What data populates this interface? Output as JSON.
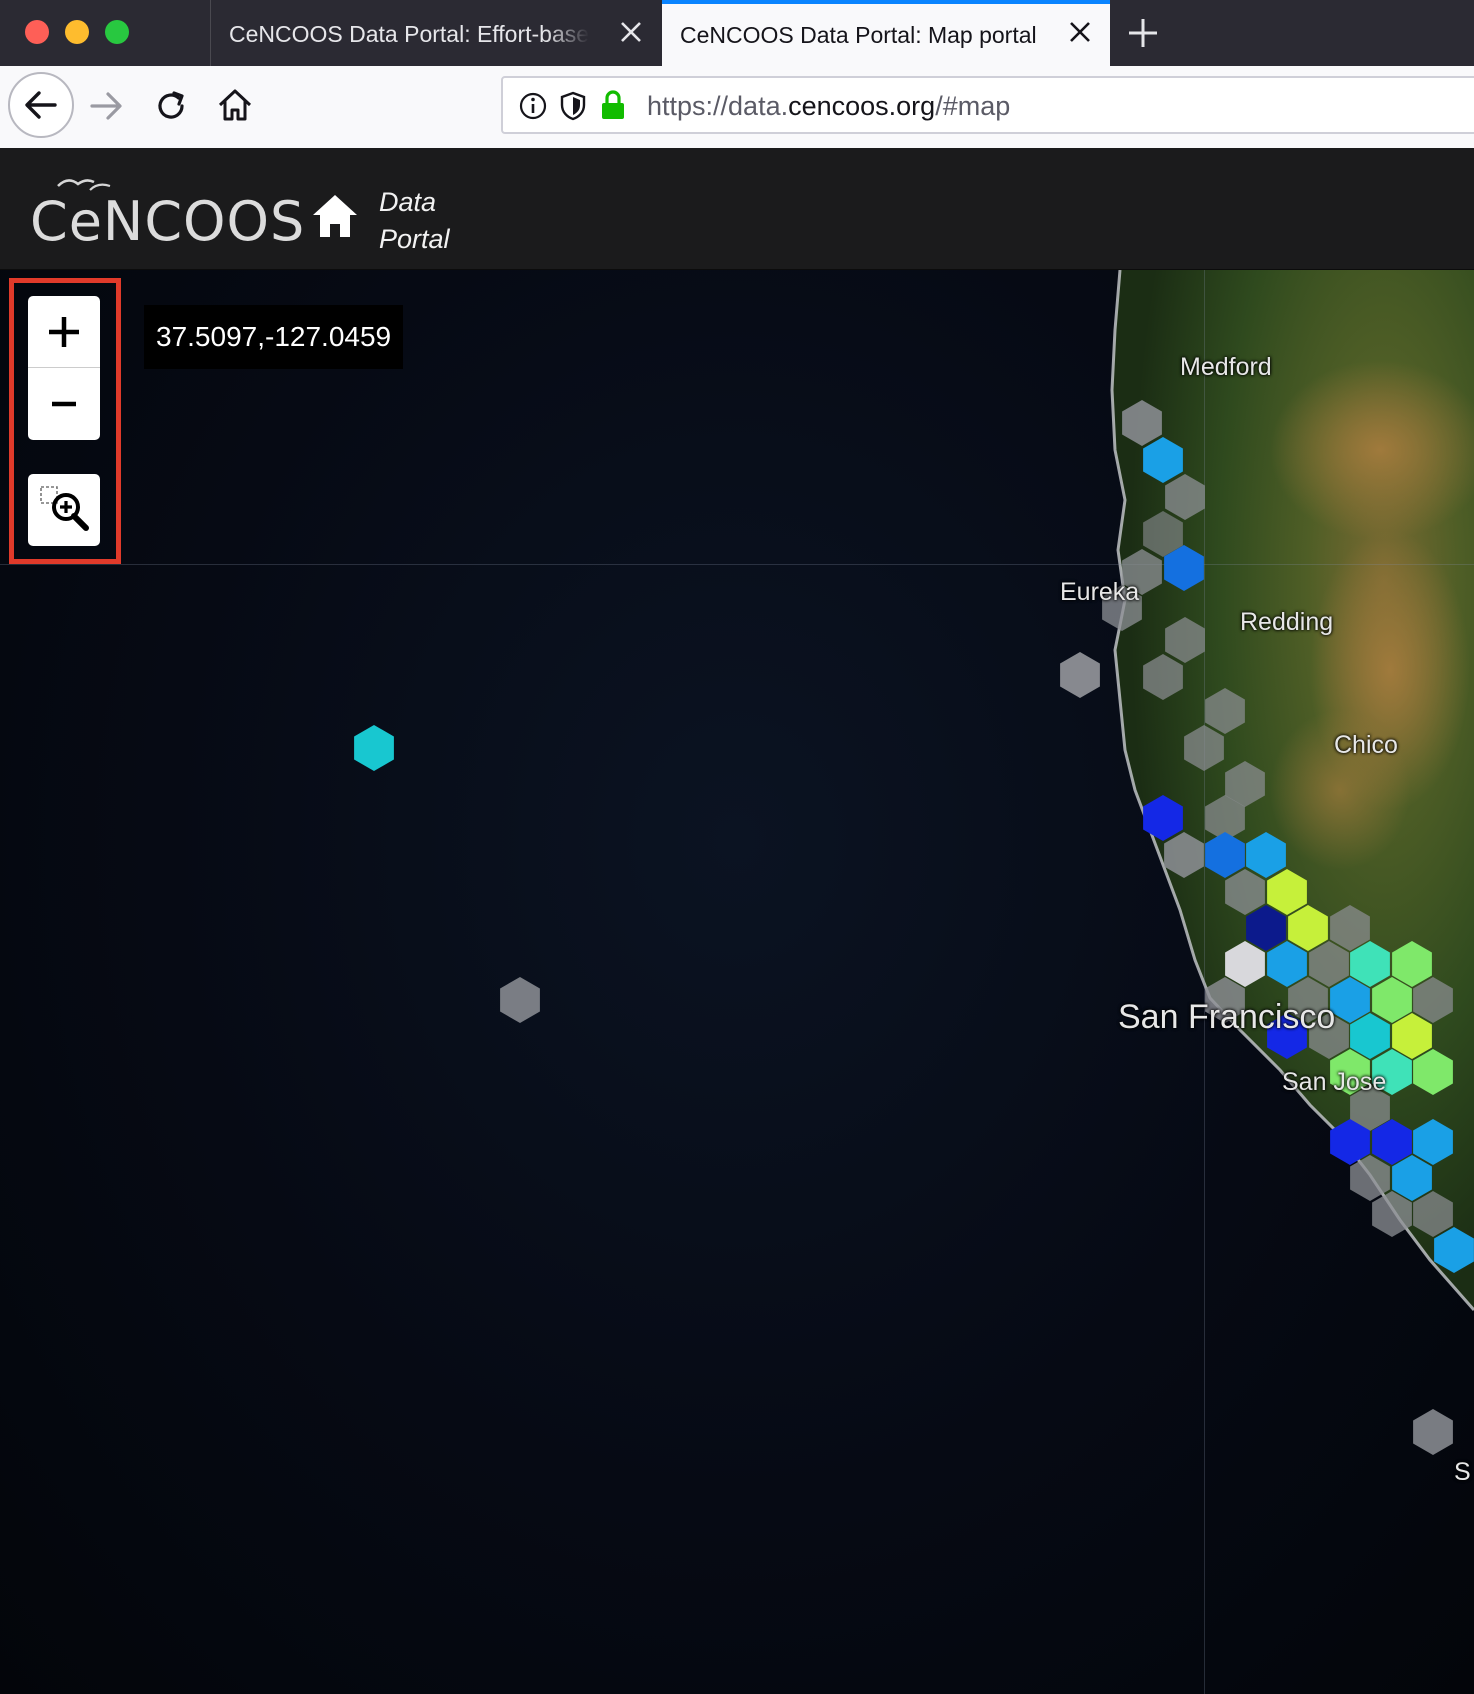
{
  "browser": {
    "tabs": [
      {
        "title": "CeNCOOS Data Portal: Effort-based",
        "active": false
      },
      {
        "title": "CeNCOOS Data Portal: Map portal",
        "active": true
      }
    ],
    "url": {
      "prefix": "https://data.",
      "domain": "cencoos.org",
      "suffix": "/#map"
    }
  },
  "site": {
    "logo": "CeNCOOS",
    "nav_label_line1": "Data",
    "nav_label_line2": "Portal"
  },
  "map": {
    "cursor_coordinates": "37.5097,-127.0459",
    "zoom_in_label": "+",
    "zoom_out_label": "−",
    "cities": {
      "medford": "Medford",
      "eureka": "Eureka",
      "redding": "Redding",
      "chico": "Chico",
      "san_francisco": "San Francisco",
      "san_jose": "San Jose",
      "partial": "S"
    },
    "highlight_color": "#e03a2a",
    "hex_colors": {
      "gray": "#8e9096",
      "light_gray": "#d8d8dc",
      "cyan": "#18c7d0",
      "sky": "#1aa0e6",
      "blue": "#1470e0",
      "deep_blue": "#1428e6",
      "navy": "#0c1a8c",
      "yellow_green": "#c6f03a",
      "green": "#7fe86a",
      "aqua_green": "#3fe2b8"
    }
  }
}
